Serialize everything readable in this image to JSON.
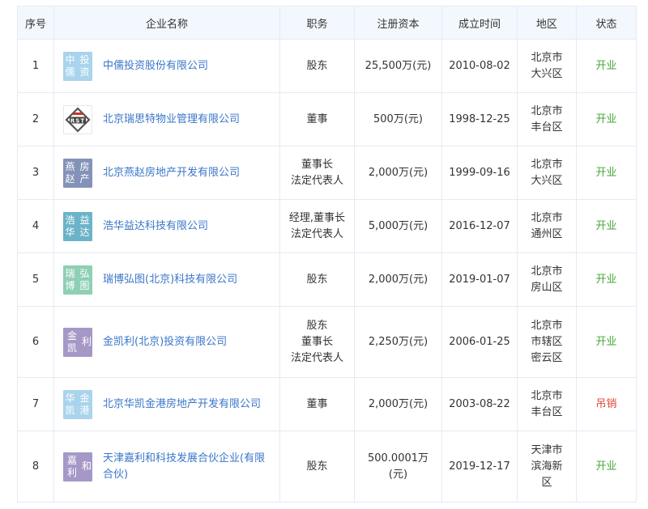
{
  "headers": {
    "no": "序号",
    "name": "企业名称",
    "position": "职务",
    "capital": "注册资本",
    "date": "成立时间",
    "area": "地区",
    "status": "状态"
  },
  "rows": [
    {
      "no": "1",
      "logo_lines": [
        "中儒",
        "投资"
      ],
      "logo_color": "#a9d4ec",
      "name": "中儒投资股份有限公司",
      "position": [
        "股东"
      ],
      "capital": [
        "25,500万(元)"
      ],
      "date": "2010-08-02",
      "area": [
        "北京市",
        "大兴区"
      ],
      "status": "开业",
      "status_color": "#4aa63c"
    },
    {
      "no": "2",
      "logo_icon": "rst-logo-icon",
      "logo_text": "RST",
      "name": "北京瑞思特物业管理有限公司",
      "position": [
        "董事"
      ],
      "capital": [
        "500万(元)"
      ],
      "date": "1998-12-25",
      "area": [
        "北京市",
        "丰台区"
      ],
      "status": "开业",
      "status_color": "#4aa63c"
    },
    {
      "no": "3",
      "logo_lines": [
        "燕赵",
        "房产"
      ],
      "logo_color": "#8392b8",
      "name": "北京燕赵房地产开发有限公司",
      "position": [
        "董事长",
        "法定代表人"
      ],
      "capital": [
        "2,000万(元)"
      ],
      "date": "1999-09-16",
      "area": [
        "北京市",
        "大兴区"
      ],
      "status": "开业",
      "status_color": "#4aa63c"
    },
    {
      "no": "4",
      "logo_lines": [
        "浩华",
        "益达"
      ],
      "logo_color": "#6bb3c8",
      "name": "浩华益达科技有限公司",
      "position": [
        "经理,董事长",
        "法定代表人"
      ],
      "capital": [
        "5,000万(元)"
      ],
      "date": "2016-12-07",
      "area": [
        "北京市",
        "通州区"
      ],
      "status": "开业",
      "status_color": "#4aa63c"
    },
    {
      "no": "5",
      "logo_lines": [
        "瑞博",
        "弘图"
      ],
      "logo_color": "#8fcfb5",
      "name": "瑞博弘图(北京)科技有限公司",
      "position": [
        "股东"
      ],
      "capital": [
        "2,000万(元)"
      ],
      "date": "2019-01-07",
      "area": [
        "北京市",
        "房山区"
      ],
      "status": "开业",
      "status_color": "#4aa63c"
    },
    {
      "no": "6",
      "logo_lines": [
        "金凯",
        "利"
      ],
      "logo_color": "#a598c7",
      "name": "金凯利(北京)投资有限公司",
      "position": [
        "股东",
        "董事长",
        "法定代表人"
      ],
      "capital": [
        "2,250万(元)"
      ],
      "date": "2006-01-25",
      "area": [
        "北京市",
        "市辖区",
        "密云区"
      ],
      "status": "开业",
      "status_color": "#4aa63c"
    },
    {
      "no": "7",
      "logo_lines": [
        "华凯",
        "金港"
      ],
      "logo_color": "#a9d4ec",
      "name": "北京华凯金港房地产开发有限公司",
      "position": [
        "董事"
      ],
      "capital": [
        "2,000万(元)"
      ],
      "date": "2003-08-22",
      "area": [
        "北京市",
        "丰台区"
      ],
      "status": "吊销",
      "status_color": "#e0463a"
    },
    {
      "no": "8",
      "logo_lines": [
        "嘉利",
        "和"
      ],
      "logo_color": "#a598c7",
      "name": "天津嘉利和科技发展合伙企业(有限合伙)",
      "position": [
        "股东"
      ],
      "capital": [
        "500.0001万",
        "(元)"
      ],
      "date": "2019-12-17",
      "area": [
        "天津市",
        "滨海新",
        "区"
      ],
      "status": "开业",
      "status_color": "#4aa63c"
    }
  ]
}
